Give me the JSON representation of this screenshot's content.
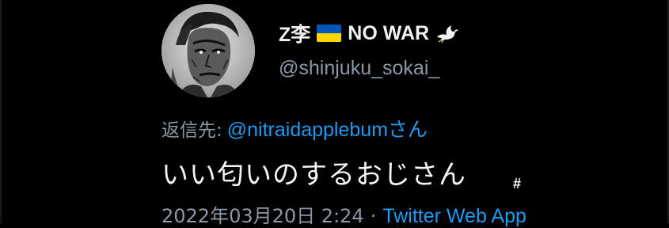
{
  "tweet": {
    "author": {
      "display_name": "Z李",
      "display_name_suffix": "NO WAR",
      "flag_icon": "ukraine-flag-icon",
      "dove_icon": "dove-icon",
      "handle": "@shinjuku_sokai_"
    },
    "reply": {
      "label": "返信先:",
      "mention": "@nitraidapplebumさん"
    },
    "text": "いい匂いのするおじさん",
    "overlay_mark": "#",
    "timestamp": "2022年03月20日 2:24",
    "separator": "·",
    "source": "Twitter Web App"
  },
  "colors": {
    "background": "#000000",
    "primary_text": "#e7e9ea",
    "secondary_text": "#8b98a5",
    "link": "#1d9bf0",
    "flag_blue": "#0057b7",
    "flag_yellow": "#ffd700"
  }
}
